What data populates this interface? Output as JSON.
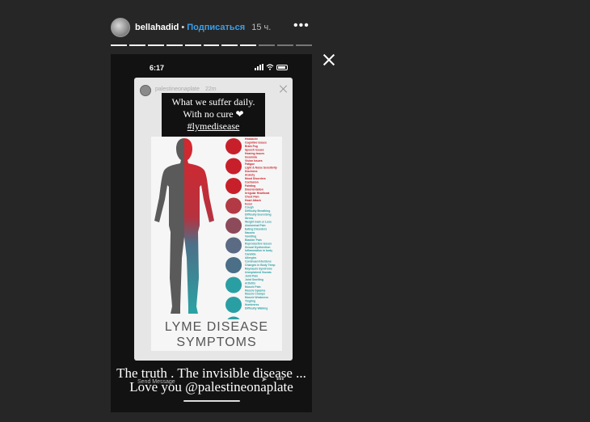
{
  "header": {
    "username": "bellahadid",
    "separator": "•",
    "follow_label": "Подписаться",
    "time": "15 ч.",
    "more_label": "•••"
  },
  "progress": {
    "segments_total": 11,
    "segments_done": 8
  },
  "story": {
    "status_time": "6:17",
    "card": {
      "username": "palestineonaplate",
      "time": "22m",
      "quote_line1": "What we suffer daily.",
      "quote_line2": "With no cure ❤",
      "quote_tag": "#lymedisease",
      "title_line1": "LYME DISEASE",
      "title_line2": "SYMPTOMS",
      "symptoms_red": [
        "Headache",
        "Cognitive Issues",
        "Brain Fog",
        "Speech Issues",
        "Hearing Issues",
        "Insomnia",
        "Vision Issues",
        "Fatigue",
        "Light & Noise Sensitivity",
        "Dizziness",
        "Anxiety",
        "Mood Disorders",
        "Confusion",
        "Fainting",
        "Disorientation",
        "Irregular Heartbeat",
        "Chest Pain",
        "Heart Attack",
        "Fever"
      ],
      "symptoms_blue": [
        "Cough",
        "Difficulty Breathing",
        "Difficulty Exercising",
        "Stress",
        "Weight Gain or Loss",
        "Abdominal Pain",
        "Eating Disorders",
        "Nausea",
        "Vomiting",
        "Bladder Pain",
        "Reproductive Issues",
        "Sexual Dysfunction",
        "Inflammation in body",
        "Candida",
        "Allergies",
        "Continual Infections",
        "Changes in Body Temp",
        "Raynauds Syndrome",
        "Unexplained Sweats",
        "Joint Pain",
        "Joint Swelling",
        "Arthritis",
        "Muscle Pain",
        "Muscle Spasms",
        "Muscle Cramps",
        "Muscle Weakness",
        "Tingling",
        "Numbness",
        "Difficulty Walking"
      ]
    },
    "caption": "The truth . The invisible disease ... Love you @palestineonaplate",
    "send_placeholder": "Send Message"
  },
  "colors": {
    "accent": "#3a9fe8",
    "red": "#c8202a",
    "teal": "#2a9fa3",
    "slate": "#4a6f86"
  }
}
